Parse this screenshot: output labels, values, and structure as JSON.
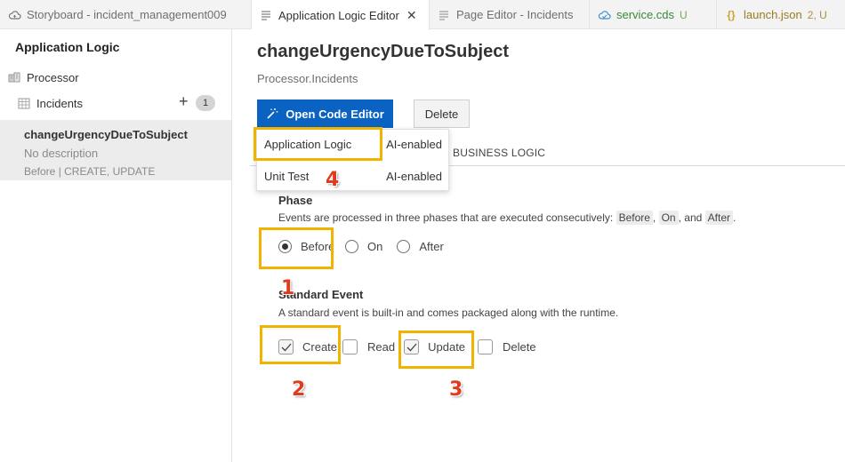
{
  "tabs": [
    {
      "label": "Storyboard - incident_management009",
      "icon": "cloud-icon",
      "active": false
    },
    {
      "label": "Application Logic Editor",
      "icon": "lines-icon",
      "active": true
    },
    {
      "label": "Page Editor - Incidents",
      "icon": "lines-icon",
      "active": false
    },
    {
      "label": "service.cds",
      "badge": "U",
      "icon": "cds-icon",
      "active": false
    },
    {
      "label": "launch.json",
      "badge": "2, U",
      "icon": "braces-icon",
      "active": false
    }
  ],
  "sidebar": {
    "title": "Application Logic",
    "items": [
      {
        "label": "Processor",
        "icon": "processor-icon"
      },
      {
        "label": "Incidents",
        "icon": "table-icon",
        "count": "1",
        "add": "+"
      }
    ],
    "selected": {
      "name": "changeUrgencyDueToSubject",
      "description": "No description",
      "meta": "Before | CREATE, UPDATE"
    }
  },
  "main": {
    "title": "changeUrgencyDueToSubject",
    "subtitle": "Processor.Incidents",
    "open_code_editor": "Open Code Editor",
    "delete": "Delete",
    "subtab": "BUSINESS LOGIC",
    "dropdown": [
      {
        "label": "Application Logic",
        "tag": "AI-enabled"
      },
      {
        "label": "Unit Test",
        "tag": "AI-enabled"
      }
    ],
    "phase": {
      "title": "Phase",
      "desc_prefix": "Events are processed in three phases that are executed consecutively: ",
      "chip1": "Before",
      "sep1": ", ",
      "chip2": "On",
      "sep2": ", and ",
      "chip3": "After",
      "desc_suffix": ".",
      "options": [
        "Before",
        "On",
        "After"
      ],
      "selected": "Before"
    },
    "standard_event": {
      "title": "Standard Event",
      "desc": "A standard event is built-in and comes packaged along with the runtime.",
      "options": [
        {
          "label": "Create",
          "checked": true
        },
        {
          "label": "Read",
          "checked": false
        },
        {
          "label": "Update",
          "checked": true
        },
        {
          "label": "Delete",
          "checked": false
        }
      ]
    }
  },
  "annotations": [
    "1",
    "2",
    "3",
    "4"
  ],
  "colors": {
    "primary": "#0a62c2",
    "highlight": "#f0b400",
    "annotation": "#e03b1e"
  }
}
